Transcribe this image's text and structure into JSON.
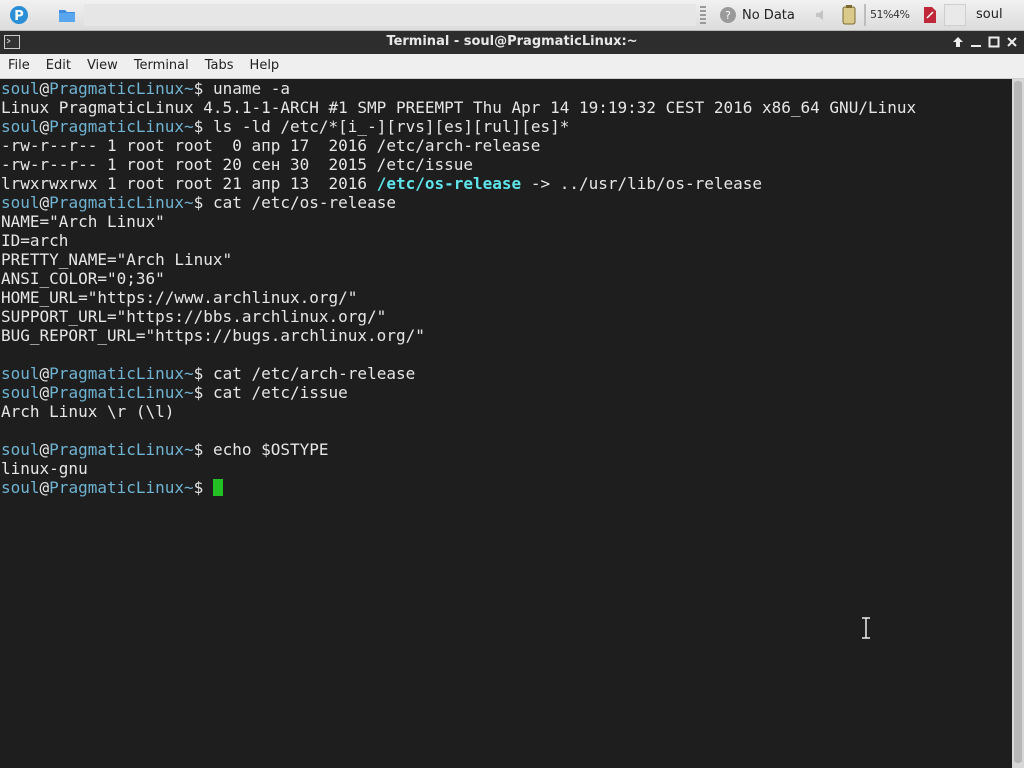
{
  "panel": {
    "weather_text": "No Data",
    "cpu_text": "51%4%",
    "user_name": "soul"
  },
  "window": {
    "title": "Terminal - soul@PragmaticLinux:~"
  },
  "menu": [
    "File",
    "Edit",
    "View",
    "Terminal",
    "Tabs",
    "Help"
  ],
  "prompt": {
    "user": "soul",
    "at": "@",
    "host": "PragmaticLinux",
    "path": "~",
    "symbol": "$ "
  },
  "terminal": {
    "lines": [
      {
        "type": "prompt",
        "cmd": "uname -a"
      },
      {
        "type": "out",
        "text": "Linux PragmaticLinux 4.5.1-1-ARCH #1 SMP PREEMPT Thu Apr 14 19:19:32 CEST 2016 x86_64 GNU/Linux"
      },
      {
        "type": "prompt",
        "cmd": "ls -ld /etc/*[i_-][rvs][es][rul][es]*"
      },
      {
        "type": "out",
        "text": "-rw-r--r-- 1 root root  0 апр 17  2016 /etc/arch-release"
      },
      {
        "type": "out",
        "text": "-rw-r--r-- 1 root root 20 сен 30  2015 /etc/issue"
      },
      {
        "type": "link",
        "before": "lrwxrwxrwx 1 root root 21 апр 13  2016 ",
        "link": "/etc/os-release",
        "after": " -> ../usr/lib/os-release"
      },
      {
        "type": "prompt",
        "cmd": "cat /etc/os-release"
      },
      {
        "type": "out",
        "text": "NAME=\"Arch Linux\""
      },
      {
        "type": "out",
        "text": "ID=arch"
      },
      {
        "type": "out",
        "text": "PRETTY_NAME=\"Arch Linux\""
      },
      {
        "type": "out",
        "text": "ANSI_COLOR=\"0;36\""
      },
      {
        "type": "out",
        "text": "HOME_URL=\"https://www.archlinux.org/\""
      },
      {
        "type": "out",
        "text": "SUPPORT_URL=\"https://bbs.archlinux.org/\""
      },
      {
        "type": "out",
        "text": "BUG_REPORT_URL=\"https://bugs.archlinux.org/\""
      },
      {
        "type": "out",
        "text": ""
      },
      {
        "type": "prompt",
        "cmd": "cat /etc/arch-release"
      },
      {
        "type": "prompt",
        "cmd": "cat /etc/issue"
      },
      {
        "type": "out",
        "text": "Arch Linux \\r (\\l)"
      },
      {
        "type": "out",
        "text": ""
      },
      {
        "type": "prompt",
        "cmd": "echo $OSTYPE"
      },
      {
        "type": "out",
        "text": "linux-gnu"
      },
      {
        "type": "cursor",
        "cmd": ""
      }
    ]
  },
  "colors": {
    "prompt": "#6fb3d2",
    "link": "#5ee4ea",
    "cursor": "#22c022",
    "background": "#1e1e1e",
    "foreground": "#e6e6e6"
  },
  "icons": {
    "launcher_1": "pragmatic-logo-icon",
    "launcher_2": "folder-icon",
    "weather": "weather-unknown-icon",
    "battery": "battery-icon",
    "pdf": "pdf-icon"
  }
}
